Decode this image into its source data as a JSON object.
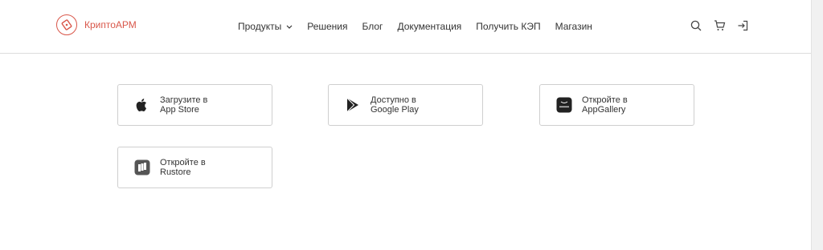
{
  "header": {
    "logo_text": "КриптоАРМ",
    "nav": [
      {
        "label": "Продукты"
      },
      {
        "label": "Решения"
      },
      {
        "label": "Блог"
      },
      {
        "label": "Документация"
      },
      {
        "label": "Получить КЭП"
      },
      {
        "label": "Магазин"
      }
    ],
    "icons": [
      "search-icon",
      "cart-icon",
      "login-icon"
    ]
  },
  "stores": [
    {
      "line1": "Загрузите в",
      "line2": "App Store",
      "icon": "apple-icon"
    },
    {
      "line1": "Доступно в",
      "line2": "Google Play",
      "icon": "google-play-icon"
    },
    {
      "line1": "Откройте в",
      "line2": "AppGallery",
      "icon": "appgallery-icon"
    },
    {
      "line1": "Откройте в",
      "line2": "Rustore",
      "icon": "rustore-icon"
    }
  ],
  "colors": {
    "brand": "#d9574a",
    "text": "#333333",
    "border": "#cfcfcf"
  }
}
